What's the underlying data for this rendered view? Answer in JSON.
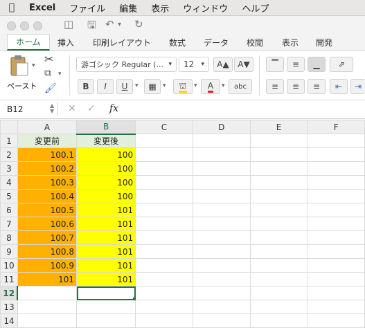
{
  "menubar": {
    "app": "Excel",
    "items": [
      "ファイル",
      "編集",
      "表示",
      "ウィンドウ",
      "ヘルプ"
    ]
  },
  "ribbon": {
    "tabs": [
      "ホーム",
      "挿入",
      "印刷レイアウト",
      "数式",
      "データ",
      "校閲",
      "表示",
      "開発"
    ],
    "active_tab": "ホーム",
    "paste_label": "ペースト",
    "font_name": "游ゴシック Regular (...",
    "font_size": "12",
    "bold": "B",
    "italic": "I",
    "underline": "U",
    "grow_font": "A▲",
    "shrink_font": "A▼",
    "abc_label": "abc"
  },
  "formula_bar": {
    "name_box": "B12",
    "fx": "fx",
    "value": ""
  },
  "sheet": {
    "columns": [
      "A",
      "B",
      "C",
      "D",
      "E",
      "F"
    ],
    "selected_column": "B",
    "selected_row": "12",
    "rows": [
      {
        "n": "1",
        "a": "変更前",
        "b": "変更後"
      },
      {
        "n": "2",
        "a": "100.1",
        "b": "100"
      },
      {
        "n": "3",
        "a": "100.2",
        "b": "100"
      },
      {
        "n": "4",
        "a": "100.3",
        "b": "100"
      },
      {
        "n": "5",
        "a": "100.4",
        "b": "100"
      },
      {
        "n": "6",
        "a": "100.5",
        "b": "101"
      },
      {
        "n": "7",
        "a": "100.6",
        "b": "101"
      },
      {
        "n": "8",
        "a": "100.7",
        "b": "101"
      },
      {
        "n": "9",
        "a": "100.8",
        "b": "101"
      },
      {
        "n": "10",
        "a": "100.9",
        "b": "101"
      },
      {
        "n": "11",
        "a": "101",
        "b": "101"
      },
      {
        "n": "12",
        "a": "",
        "b": ""
      },
      {
        "n": "13",
        "a": "",
        "b": ""
      },
      {
        "n": "14",
        "a": "",
        "b": ""
      }
    ],
    "colors": {
      "header_fill": "#e2efda",
      "col_a_fill": "#ffb000",
      "col_b_fill": "#ffff00",
      "accent": "#1f7244"
    }
  }
}
